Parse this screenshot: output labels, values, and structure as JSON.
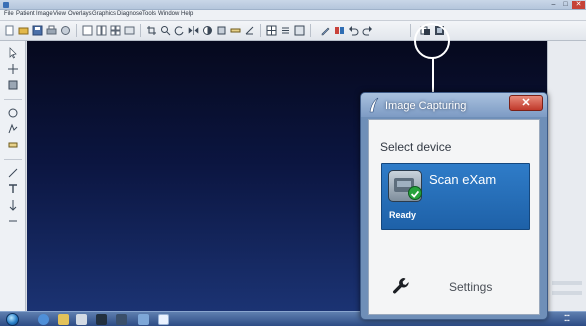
{
  "menu": {
    "items": [
      "File",
      "Patient",
      "Image",
      "View",
      "Overlays",
      "Graphics",
      "Diagnose",
      "Tools",
      "Window",
      "Help"
    ]
  },
  "dialog": {
    "title": "Image Capturing",
    "close_label": "✕",
    "section_label": "Select device",
    "device": {
      "name": "Scan eXam",
      "status": "Ready"
    },
    "settings_label": "Settings"
  },
  "colors": {
    "canvas_top": "#06091d",
    "canvas_bottom": "#1b3373",
    "device_button": "#2f7cc8",
    "close_button": "#c0392b"
  },
  "icons": {
    "toolbar": [
      "new-icon",
      "open-icon",
      "save-icon",
      "print-icon",
      "acquire-icon",
      "zoom-icon",
      "rotate-icon",
      "undo-icon",
      "redo-icon",
      "image-capture-icon"
    ],
    "sidebar": [
      "select-icon",
      "pan-icon",
      "measure-icon",
      "annotate-icon",
      "calibrate-icon",
      "text-icon"
    ]
  }
}
